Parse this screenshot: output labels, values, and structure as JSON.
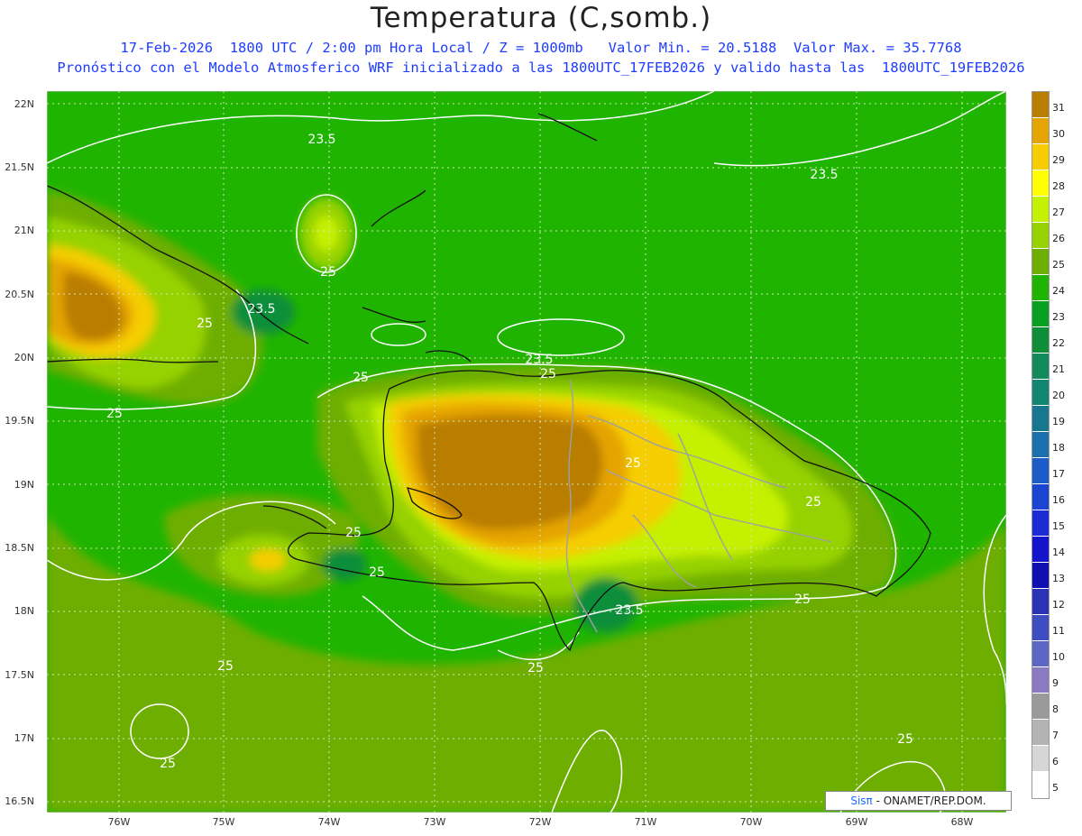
{
  "header": {
    "title": "Temperatura (C,somb.)",
    "line1": "17-Feb-2026  1800 UTC / 2:00 pm Hora Local / Z = 1000mb   Valor Min. = 20.5188  Valor Max. = 35.7768",
    "line2": "Pronóstico con el Modelo Atmosferico WRF inicializado a las 1800UTC_17FEB2026 y valido hasta las  1800UTC_19FEB2026"
  },
  "axes": {
    "lat_labels": [
      "22N",
      "21.5N",
      "21N",
      "20.5N",
      "20N",
      "19.5N",
      "19N",
      "18.5N",
      "18N",
      "17.5N",
      "17N",
      "16.5N"
    ],
    "lon_labels": [
      "76W",
      "75W",
      "74W",
      "73W",
      "72W",
      "71W",
      "70W",
      "69W",
      "68W"
    ]
  },
  "contour_labels": [
    "23.5",
    "23.5",
    "23.5",
    "23.5",
    "25",
    "25",
    "25",
    "25",
    "25",
    "25",
    "25",
    "25",
    "25",
    "25",
    "25",
    "25",
    "23.5"
  ],
  "legend": {
    "labels": [
      "31",
      "30",
      "29",
      "28",
      "27",
      "26",
      "25",
      "24",
      "23",
      "22",
      "21",
      "20",
      "19",
      "18",
      "17",
      "16",
      "15",
      "14",
      "13",
      "12",
      "11",
      "10",
      "9",
      "8",
      "7",
      "6",
      "5"
    ],
    "colors": [
      "#b97d00",
      "#e5a400",
      "#f5cd00",
      "#ffff00",
      "#c5f000",
      "#96d200",
      "#6eae00",
      "#1fb400",
      "#08a020",
      "#0f8e3a",
      "#138a5c",
      "#128673",
      "#16778e",
      "#1a6fae",
      "#1c5cc8",
      "#1c44d2",
      "#1c2cd4",
      "#1414cc",
      "#1010b0",
      "#2a32b6",
      "#3f4dc2",
      "#5c66c4",
      "#8a7bc0",
      "#9a9a9a",
      "#b3b3b3",
      "#d6d6d6",
      "#ffffff"
    ]
  },
  "credit": {
    "sis": "Sisπ",
    "text": " - ONAMET/REP.DOM."
  }
}
